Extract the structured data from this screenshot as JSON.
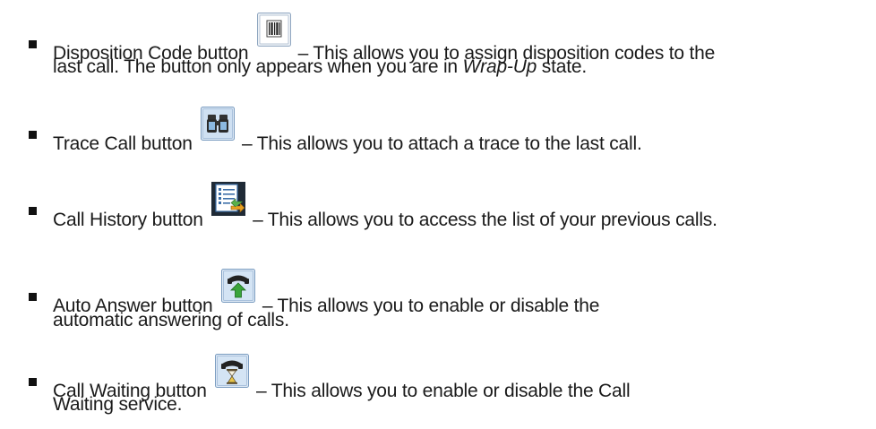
{
  "items": [
    {
      "label": "Disposition Code button",
      "icon": "barcode-icon",
      "desc1": "– This allows you to assign disposition codes to the",
      "desc2_pre": "last call. The button only appears when you are in ",
      "desc2_em": "Wrap-Up",
      "desc2_post": " state."
    },
    {
      "label": "Trace Call button",
      "icon": "binoculars-icon",
      "desc1": "– This allows you to attach a trace to the last call."
    },
    {
      "label": "Call History button",
      "icon": "call-history-list-icon",
      "desc1": "– This allows you to access the list of your previous calls."
    },
    {
      "label": "Auto Answer button",
      "icon": "phone-answer-arrow-icon",
      "desc1": "– This allows you to enable or disable the",
      "desc2": "automatic answering of calls."
    },
    {
      "label": "Call Waiting button",
      "icon": "phone-hourglass-icon",
      "desc1": "– This allows you to enable or disable the Call",
      "desc2": "Waiting service."
    }
  ],
  "colors": {
    "text": "#1a1a1a",
    "icon_border": "#7a9cc0",
    "icon_bg": "#dfeaf6",
    "icon_green": "#3aa43a",
    "icon_dark": "#222222"
  }
}
